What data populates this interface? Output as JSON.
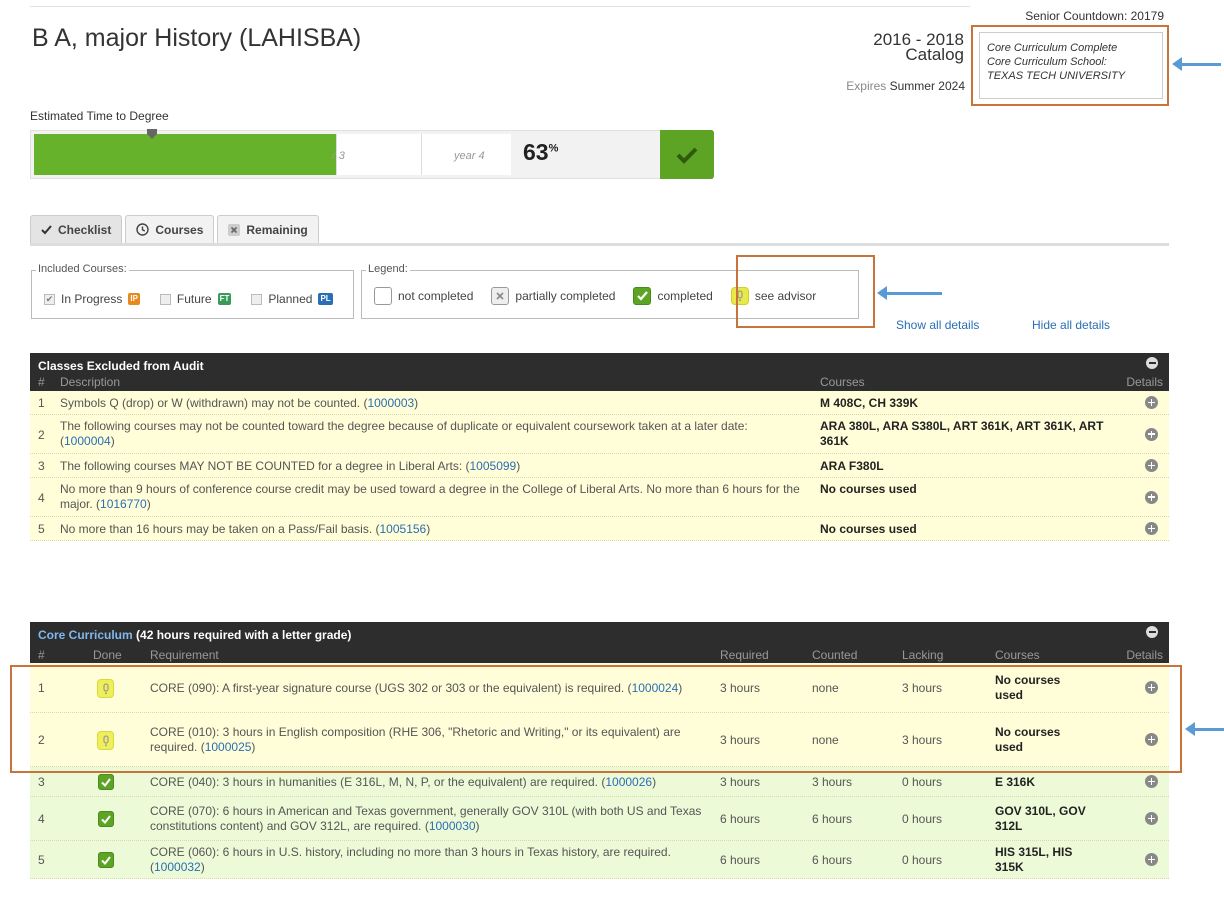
{
  "header": {
    "countdown": "Senior Countdown: 20179",
    "title": "B A, major History (LAHISBA)",
    "catalog_years": "2016 - 2018",
    "catalog_word": "Catalog",
    "expires_label": "Expires",
    "expires_value": "Summer 2024",
    "core_box": [
      "Core Curriculum Complete",
      "Core Curriculum School:",
      "TEXAS TECH UNIVERSITY"
    ]
  },
  "progress": {
    "label": "Estimated Time to Degree",
    "fill_fraction": 0.63,
    "hint_partial": "r 3",
    "hint_year4": "year 4",
    "percent_value": "63",
    "percent_sign": "%",
    "accent": "#66b22b"
  },
  "tabs": [
    {
      "label": "Checklist",
      "icon": "check-icon",
      "active": true
    },
    {
      "label": "Courses",
      "icon": "clock-icon",
      "active": false
    },
    {
      "label": "Remaining",
      "icon": "x-icon",
      "active": false
    }
  ],
  "included": {
    "legend": "Included Courses:",
    "items": [
      {
        "label": "In Progress",
        "badge": "IP",
        "checked": true,
        "color": "#e8891d"
      },
      {
        "label": "Future",
        "badge": "FT",
        "checked": false,
        "color": "#3a9a5a"
      },
      {
        "label": "Planned",
        "badge": "PL",
        "checked": false,
        "color": "#2a6eb5"
      }
    ]
  },
  "legend": {
    "legend": "Legend:",
    "not_completed": "not completed",
    "partially_completed": "partially completed",
    "completed": "completed",
    "see_advisor": "see advisor"
  },
  "links": {
    "show_all": "Show all details",
    "hide_all": "Hide all details"
  },
  "excluded": {
    "title": "Classes Excluded from Audit",
    "col_num": "#",
    "col_desc": "Description",
    "col_courses": "Courses",
    "col_details": "Details",
    "rows": [
      {
        "num": "1",
        "desc": "Symbols Q (drop) or W (withdrawn) may not be counted. (",
        "code": "1000003",
        "courses": "M 408C, CH 339K"
      },
      {
        "num": "2",
        "desc": "The following courses may not be counted toward the degree because of duplicate or equivalent coursework taken at a later date: (",
        "code": "1000004",
        "courses": "ARA 380L, ARA S380L, ART 361K, ART 361K, ART 361K"
      },
      {
        "num": "3",
        "desc": "The following courses MAY NOT BE COUNTED for a degree in Liberal Arts: (",
        "code": "1005099",
        "courses": "ARA F380L"
      },
      {
        "num": "4",
        "desc": "No more than 9 hours of conference course credit may be used toward a degree in the College of Liberal Arts. No more than 6 hours for the major. (",
        "code": "1016770",
        "courses": "No courses used"
      },
      {
        "num": "5",
        "desc": "No more than 16 hours may be taken on a Pass/Fail basis. (",
        "code": "1005156",
        "courses": "No courses used"
      }
    ]
  },
  "core": {
    "title_link": "Core Curriculum",
    "title_rest": " (42 hours required with a letter grade)",
    "col_num": "#",
    "col_done": "Done",
    "col_req": "Requirement",
    "col_required": "Required",
    "col_counted": "Counted",
    "col_lacking": "Lacking",
    "col_courses": "Courses",
    "col_details": "Details",
    "rows": [
      {
        "num": "1",
        "status": "advisor",
        "req": "CORE (090): A first-year signature course (UGS 302 or 303 or the equivalent) is required. (",
        "code": "1000024",
        "required": "3 hours",
        "counted": "none",
        "lacking": "3 hours",
        "courses": "No courses used"
      },
      {
        "num": "2",
        "status": "advisor",
        "req": "CORE (010): 3 hours in English composition (RHE 306, \"Rhetoric and Writing,\" or its equivalent) are required. (",
        "code": "1000025",
        "required": "3 hours",
        "counted": "none",
        "lacking": "3 hours",
        "courses": "No courses used"
      },
      {
        "num": "3",
        "status": "completed",
        "req": "CORE (040): 3 hours in humanities (E 316L, M, N, P, or the equivalent) are required. (",
        "code": "1000026",
        "required": "3 hours",
        "counted": "3 hours",
        "lacking": "0 hours",
        "courses": "E 316K"
      },
      {
        "num": "4",
        "status": "completed",
        "req": "CORE (070): 6 hours in American and Texas government, generally GOV 310L (with both US and Texas constitutions content) and GOV 312L, are required. (",
        "code": "1000030",
        "required": "6 hours",
        "counted": "6 hours",
        "lacking": "0 hours",
        "courses": "GOV 310L, GOV 312L"
      },
      {
        "num": "5",
        "status": "completed",
        "req": "CORE (060): 6 hours in U.S. history, including no more than 3 hours in Texas history, are required. (",
        "code": "1000032",
        "required": "6 hours",
        "counted": "6 hours",
        "lacking": "0 hours",
        "courses": "HIS 315L, HIS 315K"
      }
    ]
  }
}
